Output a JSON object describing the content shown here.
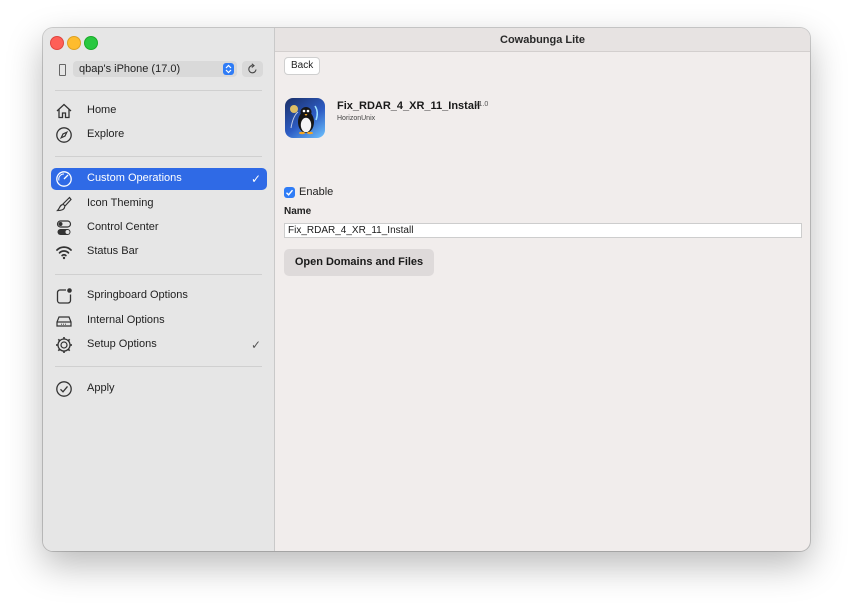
{
  "window": {
    "title": "Cowabunga Lite"
  },
  "device": {
    "selected": "qbap's iPhone (17.0)"
  },
  "sidebar": {
    "sections": [
      [
        {
          "label": "Home",
          "icon": "home-icon"
        },
        {
          "label": "Explore",
          "icon": "compass-icon"
        }
      ],
      [
        {
          "label": "Custom Operations",
          "icon": "gauge-icon",
          "selected": true,
          "checked": true
        },
        {
          "label": "Icon Theming",
          "icon": "paintbrush-icon"
        },
        {
          "label": "Control Center",
          "icon": "toggles-icon"
        },
        {
          "label": "Status Bar",
          "icon": "wifi-icon"
        }
      ],
      [
        {
          "label": "Springboard Options",
          "icon": "app-badge-icon"
        },
        {
          "label": "Internal Options",
          "icon": "drive-icon"
        },
        {
          "label": "Setup Options",
          "icon": "gear-icon",
          "checked": true
        }
      ],
      [
        {
          "label": "Apply",
          "icon": "checkmark-circle-icon"
        }
      ]
    ]
  },
  "main": {
    "back_label": "Back",
    "operation": {
      "name": "Fix_RDAR_4_XR_11_Install",
      "version": "v1.0",
      "author": "HorizonUnix"
    },
    "enable": {
      "label": "Enable",
      "checked": true
    },
    "name_field": {
      "label": "Name",
      "value": "Fix_RDAR_4_XR_11_Install"
    },
    "open_button_label": "Open Domains and Files"
  },
  "colors": {
    "accent": "#2f6ae6",
    "checkbox": "#2f7cf6"
  }
}
